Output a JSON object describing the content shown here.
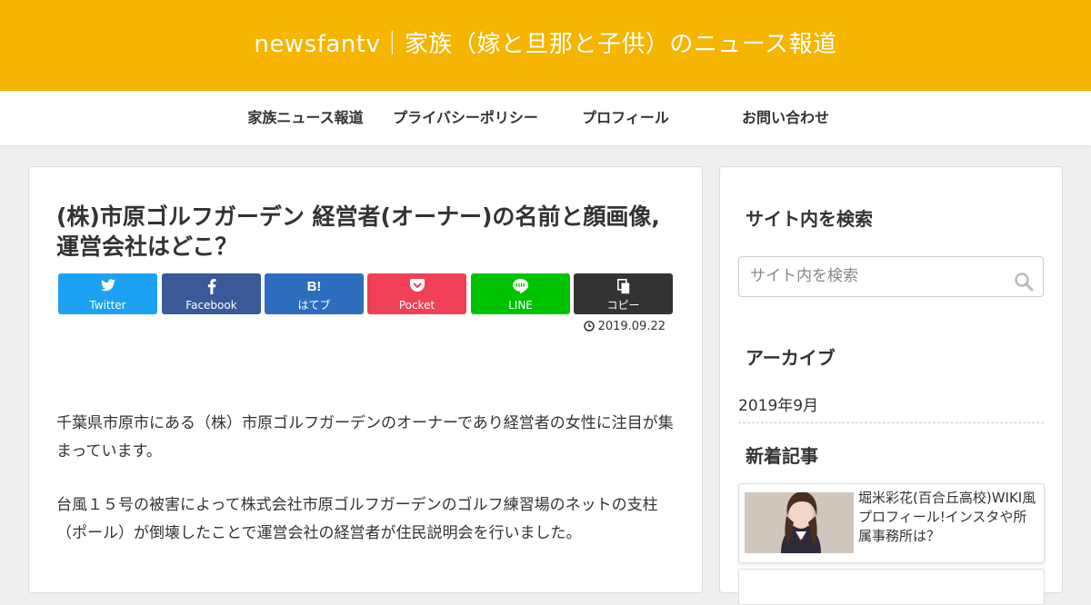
{
  "header": {
    "site_title": "newsfantv｜家族（嫁と旦那と子供）のニュース報道",
    "bg_color": "#f5b500"
  },
  "nav": {
    "items": [
      "家族ニュース報道",
      "プライバシーポリシー",
      "プロフィール",
      "お問い合わせ"
    ]
  },
  "article": {
    "title": "(株)市原ゴルフガーデン 経営者(オーナー)の名前と顔画像,運営会社はどこ？",
    "date": "2019.09.22",
    "paragraphs": [
      "千葉県市原市にある（株）市原ゴルフガーデンのオーナーであり経営者の女性に注目が集まっています。",
      "台風１５号の被害によって株式会社市原ゴルフガーデンのゴルフ練習場のネットの支柱（ポール）が倒壊したことで運営会社の経営者が住民説明会を行いました。"
    ],
    "share_buttons": [
      {
        "label": "Twitter",
        "icon": "twitter-icon",
        "color": "#1da1f2"
      },
      {
        "label": "Facebook",
        "icon": "facebook-icon",
        "color": "#3b5998"
      },
      {
        "label": "はてブ",
        "icon": "hatena-icon",
        "color": "#2c6ebd"
      },
      {
        "label": "Pocket",
        "icon": "pocket-icon",
        "color": "#ef4056"
      },
      {
        "label": "LINE",
        "icon": "line-icon",
        "color": "#00c300"
      },
      {
        "label": "コピー",
        "icon": "copy-icon",
        "color": "#333333"
      }
    ]
  },
  "sidebar": {
    "search_title": "サイト内を検索",
    "search_placeholder": "サイト内を検索",
    "archive_title": "アーカイブ",
    "archive_items": [
      "2019年9月"
    ],
    "new_title": "新着記事",
    "new_posts": [
      {
        "title": "堀米彩花(百合丘高校)WIKI風プロフィール!インスタや所属事務所は？"
      }
    ]
  }
}
